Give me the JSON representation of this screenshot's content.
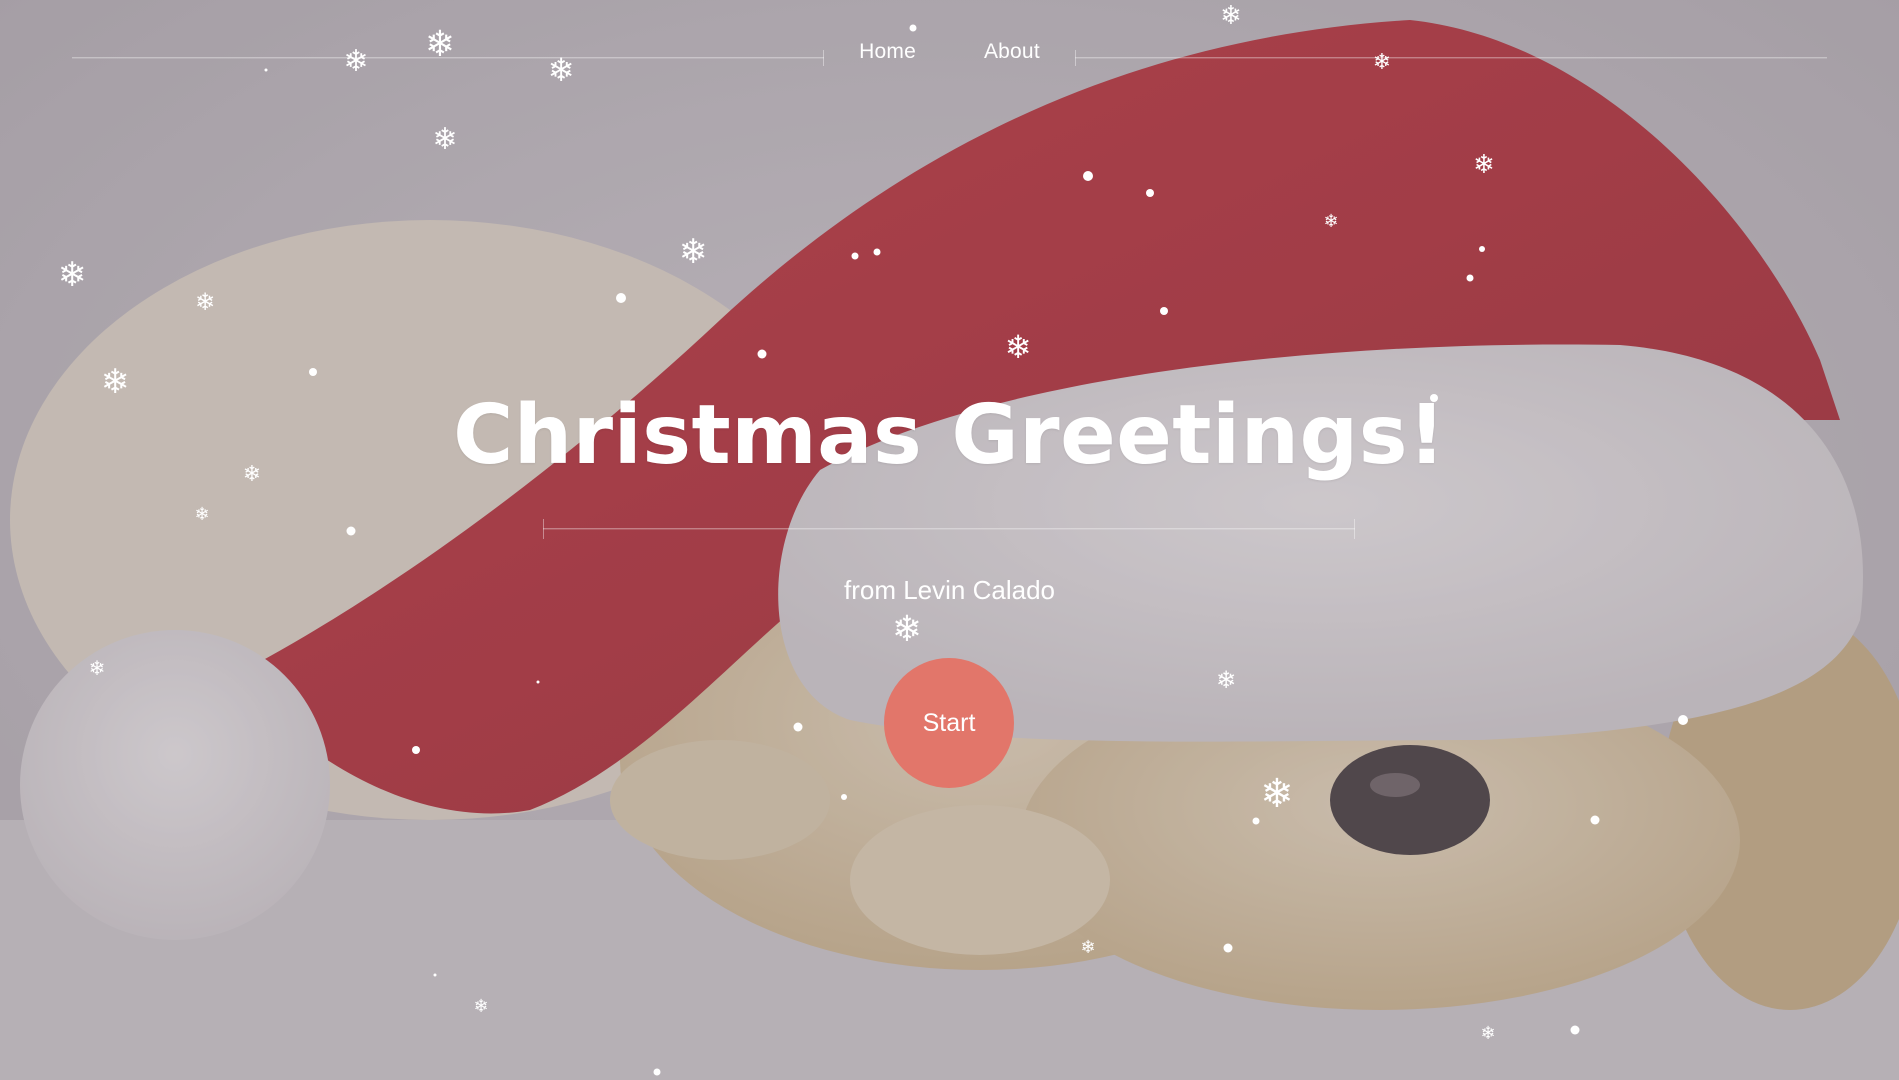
{
  "nav": {
    "items": [
      {
        "label": "Home"
      },
      {
        "label": "About"
      }
    ]
  },
  "hero": {
    "title": "Christmas Greetings!",
    "subtitle": "from Levin Calado",
    "start_label": "Start"
  },
  "theme": {
    "button_color": "#e2766a",
    "text_color": "#ffffff",
    "hat_red": "#b3262f",
    "fur_white": "#ece8ea",
    "puppy_cream": "#d9c6a4"
  },
  "background": {
    "subject": "golden retriever puppy wearing a red santa hat",
    "effect": "falling snowflakes"
  }
}
